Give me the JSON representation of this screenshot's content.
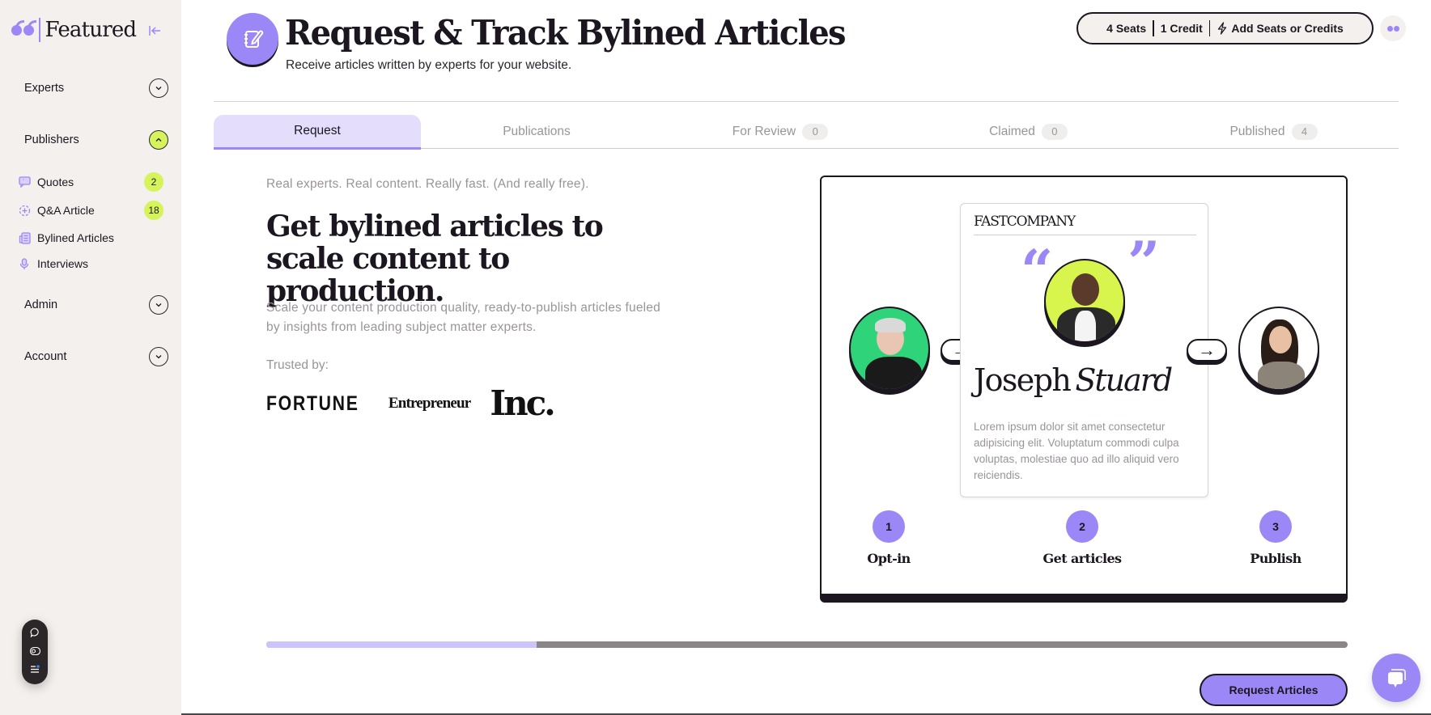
{
  "sidebar": {
    "logo_text": "Featured",
    "sections": [
      {
        "label": "Experts",
        "expanded": false
      },
      {
        "label": "Publishers",
        "expanded": true
      },
      {
        "label": "Admin",
        "expanded": false
      },
      {
        "label": "Account",
        "expanded": false
      }
    ],
    "publisher_items": [
      {
        "label": "Quotes",
        "icon": "quote-bubble-icon",
        "badge": "2"
      },
      {
        "label": "Q&A Article",
        "icon": "plus-circle-dashed-icon",
        "badge": "18"
      },
      {
        "label": "Bylined Articles",
        "icon": "newspaper-icon",
        "badge": null
      },
      {
        "label": "Interviews",
        "icon": "microphone-icon",
        "badge": null
      }
    ]
  },
  "header": {
    "title": "Request & Track Bylined Articles",
    "subtitle": "Receive articles written by experts for your website.",
    "seats": "4 Seats",
    "credits": "1 Credit",
    "add_label": "Add Seats or Credits"
  },
  "tabs": [
    {
      "label": "Request",
      "count": null,
      "active": true
    },
    {
      "label": "Publications",
      "count": null,
      "active": false
    },
    {
      "label": "For Review",
      "count": "0",
      "active": false
    },
    {
      "label": "Claimed",
      "count": "0",
      "active": false
    },
    {
      "label": "Published",
      "count": "4",
      "active": false
    }
  ],
  "intro": {
    "tagline": "Real experts. Real content. Really fast. (And really free).",
    "headline": "Get bylined articles to scale content to production.",
    "description": "Scale your content production quality, ready-to-publish articles fueled by insights from leading subject matter experts.",
    "trusted_label": "Trusted by:",
    "logos": [
      "FORTUNE",
      "Entrepreneur",
      "Inc."
    ]
  },
  "illustration": {
    "publication": "FASTCOMPANY",
    "expert_first": "Joseph",
    "expert_last": "Stuard",
    "lorem": "Lorem ipsum dolor sit amet consectetur adipisicing elit. Voluptatum commodi culpa voluptas, molestiae quo ad illo aliquid vero reiciendis.",
    "steps": [
      {
        "num": "1",
        "label": "Opt-in"
      },
      {
        "num": "2",
        "label": "Get articles"
      },
      {
        "num": "3",
        "label": "Publish"
      }
    ]
  },
  "progress": {
    "fraction": 0.25
  },
  "actions": {
    "request_label": "Request Articles"
  },
  "colors": {
    "accent": "#9b87f5",
    "lime": "#d6f35b",
    "ink": "#1c1620",
    "sidebar_bg": "#f3f0ed"
  }
}
